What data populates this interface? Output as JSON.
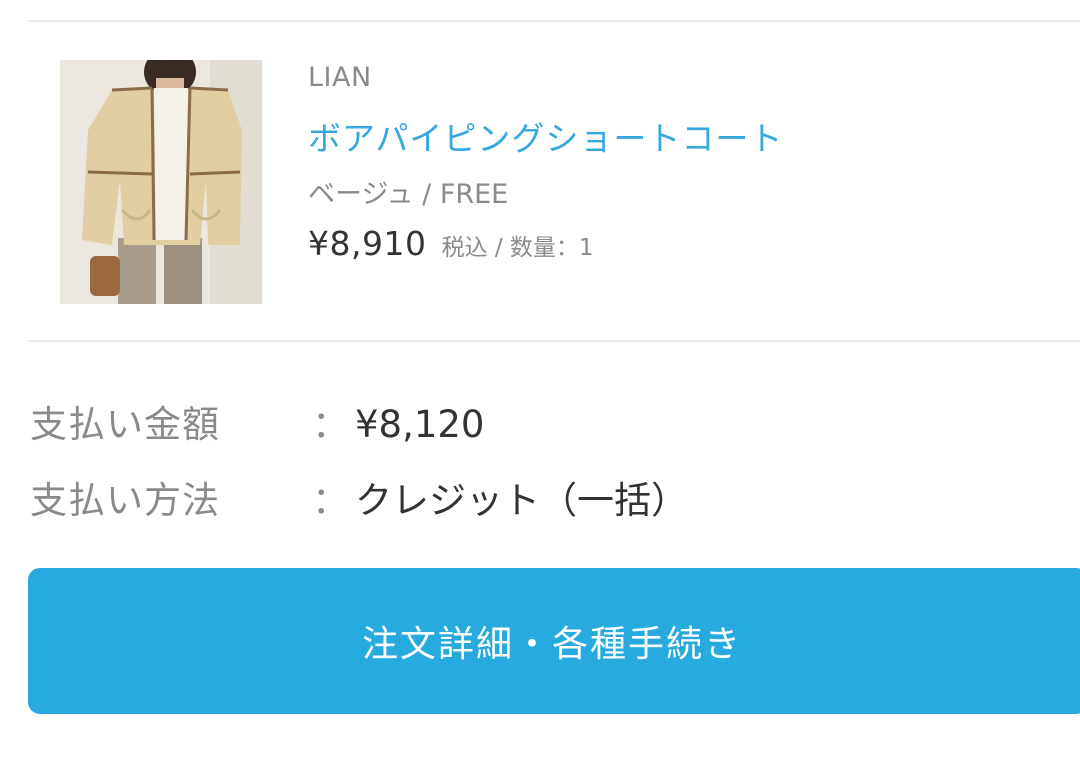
{
  "product": {
    "brand": "LIAN",
    "name": "ボアパイピングショートコート",
    "variant": "ベージュ / FREE",
    "price": "¥8,910",
    "price_meta": "税込 / 数量：1",
    "image_icon": "product-photo-beige-coat"
  },
  "payment": {
    "amount_label": "支払い金額",
    "amount_colon": "：",
    "amount_value": "¥8,120",
    "method_label": "支払い方法",
    "method_colon": "：",
    "method_value": "クレジット（一括）"
  },
  "actions": {
    "details_button_label": "注文詳細・各種手続き"
  },
  "colors": {
    "accent": "#27aade",
    "link": "#35a8dc",
    "muted_text": "#8a8a8a",
    "primary_text": "#333333",
    "divider": "#ececec"
  }
}
